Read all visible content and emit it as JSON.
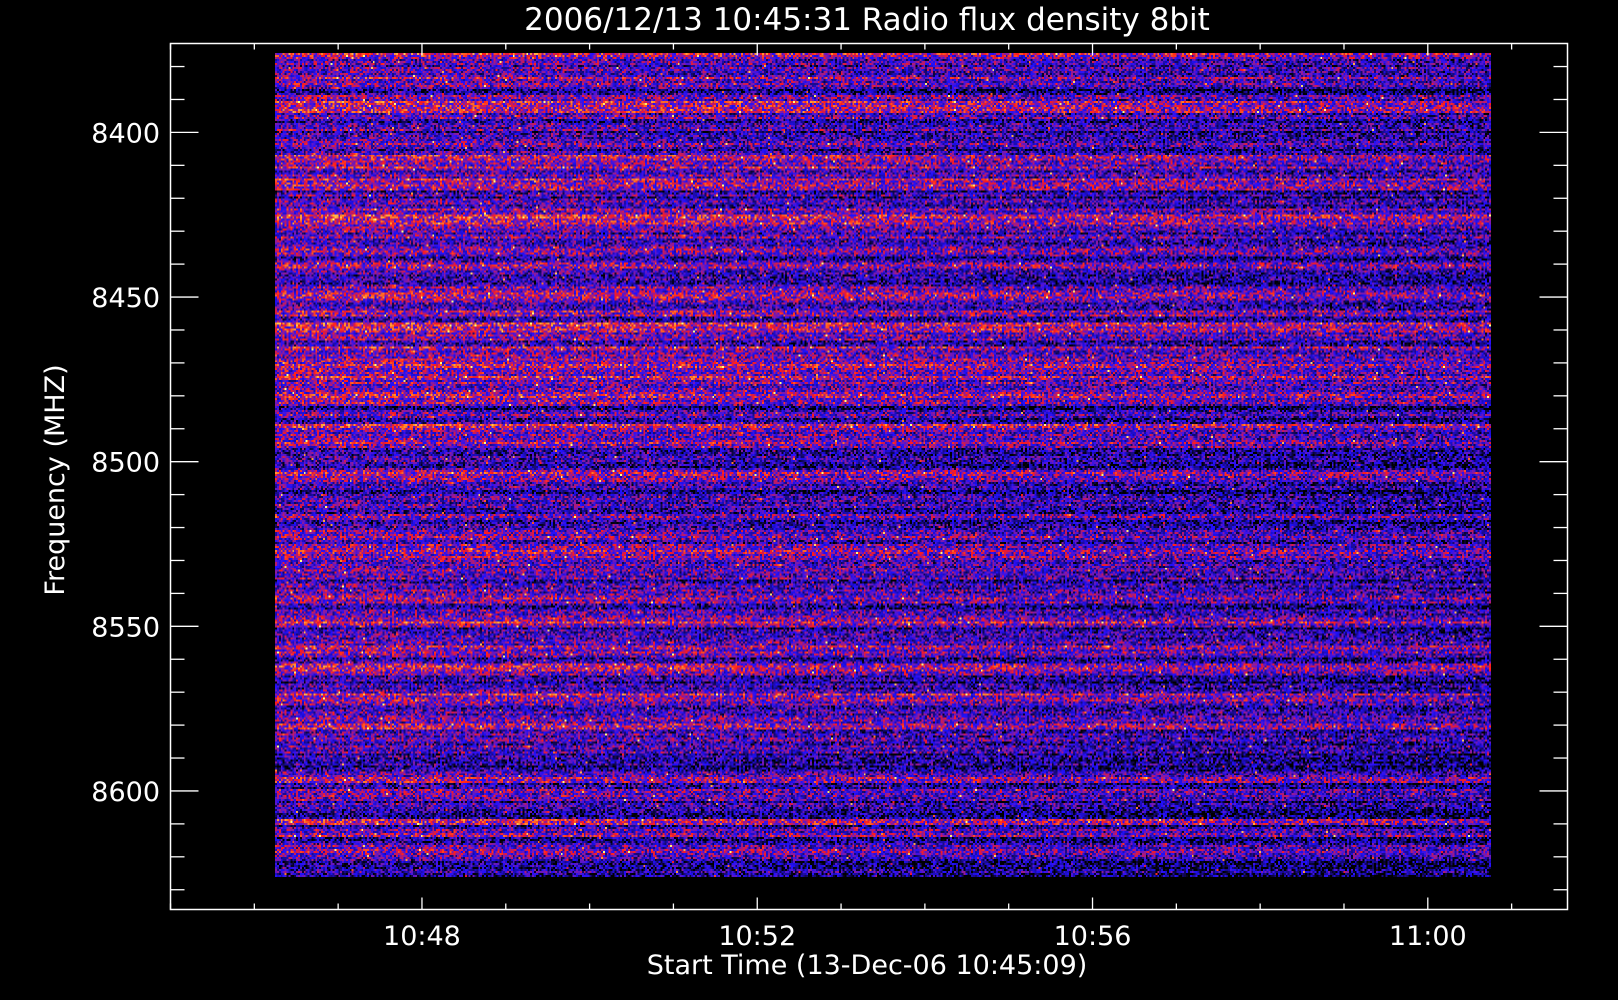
{
  "chart_data": {
    "type": "heatmap",
    "title": "2006/12/13 10:45:31 Radio flux density 8bit",
    "xlabel": "Start Time (13-Dec-06 10:45:09)",
    "ylabel": "Frequency (MHZ)",
    "x_axis": {
      "unit": "time",
      "range": [
        "10:45:00",
        "11:01:40"
      ],
      "data_range": [
        "10:46:15",
        "11:00:45"
      ],
      "major_ticks": [
        "10:48",
        "10:52",
        "10:56",
        "11:00"
      ],
      "minor_tick_interval_minutes": 1
    },
    "y_axis": {
      "unit": "MHZ",
      "range": [
        8373,
        8636
      ],
      "data_range": [
        8376,
        8626
      ],
      "inverted": true,
      "major_ticks": [
        8400,
        8450,
        8500,
        8550,
        8600
      ],
      "minor_tick_interval": 10
    },
    "colormap": [
      "#000000",
      "#1a0a8c",
      "#2010ff",
      "#8a1aa0",
      "#ff1a1a",
      "#ff8a2a",
      "#ffff80"
    ],
    "description_values": "8-bit radio flux density spectrogram; noise-dominated with horizontal frequency banding, no distinct burst",
    "grid": false,
    "legend": "none"
  },
  "colors": {
    "background": "#000000",
    "axes": "#ffffff",
    "text": "#ffffff"
  }
}
